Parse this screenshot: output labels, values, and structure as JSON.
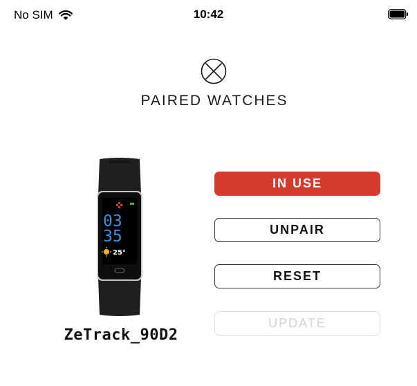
{
  "status_bar": {
    "carrier": "No SIM",
    "time": "10:42"
  },
  "page": {
    "title": "PAIRED WATCHES"
  },
  "device": {
    "name": "ZeTrack_90D2",
    "screen_hour": "03",
    "screen_minute": "35",
    "screen_temp": "25°"
  },
  "buttons": {
    "in_use": "IN USE",
    "unpair": "UNPAIR",
    "reset": "RESET",
    "update": "UPDATE"
  },
  "colors": {
    "accent": "#d73a2f",
    "disabled": "#d3d3d3"
  }
}
